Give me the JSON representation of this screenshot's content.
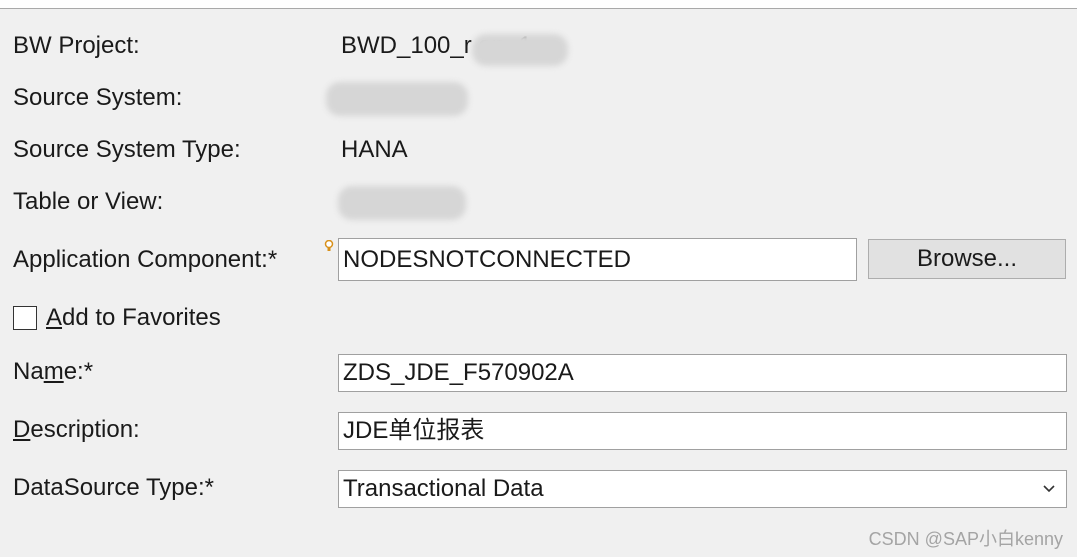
{
  "form": {
    "bw_project": {
      "label": "BW Project:",
      "value": "BWD_100_r          en_1"
    },
    "source_system": {
      "label": "Source System:"
    },
    "source_system_type": {
      "label": "Source System Type:",
      "value": "HANA"
    },
    "table_or_view": {
      "label": "Table or View:"
    },
    "application_component": {
      "label": "Application Component:*",
      "value": "NODESNOTCONNECTED",
      "browse_label": "Browse..."
    },
    "add_to_favorites": {
      "label_mnemonic": "A",
      "label_rest": "dd to Favorites",
      "checked": false
    },
    "name": {
      "label_pre": "Na",
      "label_mnemonic": "m",
      "label_post": "e:*",
      "value": "ZDS_JDE_F570902A"
    },
    "description": {
      "label_mnemonic": "D",
      "label_rest": "escription:",
      "value": "JDE单位报表"
    },
    "datasource_type": {
      "label": "DataSource Type:*",
      "value": "Transactional Data"
    }
  },
  "icons": {
    "required": "lightbulb-icon",
    "dropdown": "chevron-down-icon"
  },
  "watermark": "CSDN @SAP小白kenny"
}
